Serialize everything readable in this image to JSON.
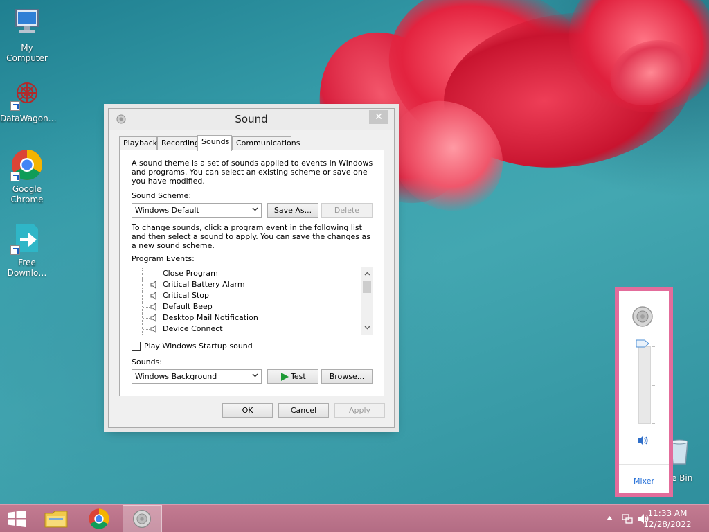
{
  "desktop": {
    "icons": [
      {
        "label": "My Computer",
        "icon": "computer-icon"
      },
      {
        "label": "DataWagon…",
        "icon": "datawagon-icon"
      },
      {
        "label": "Google Chrome",
        "icon": "chrome-icon"
      },
      {
        "label": "Free Downlo…",
        "icon": "download-manager-icon"
      }
    ],
    "recycle_bin_label": "cle Bin"
  },
  "dialog": {
    "title": "Sound",
    "tabs": [
      {
        "label": "Playback",
        "active": false
      },
      {
        "label": "Recording",
        "active": false
      },
      {
        "label": "Sounds",
        "active": true
      },
      {
        "label": "Communications",
        "active": false
      }
    ],
    "intro_text": "A sound theme is a set of sounds applied to events in Windows and programs.  You can select an existing scheme or save one you have modified.",
    "scheme_label": "Sound Scheme:",
    "scheme_value": "Windows Default",
    "save_as_label": "Save As...",
    "delete_label": "Delete",
    "change_text": "To change sounds, click a program event in the following list and then select a sound to apply.  You can save the changes as a new sound scheme.",
    "events_label": "Program Events:",
    "events": [
      {
        "label": "Close Program",
        "has_sound": false
      },
      {
        "label": "Critical Battery Alarm",
        "has_sound": true
      },
      {
        "label": "Critical Stop",
        "has_sound": true
      },
      {
        "label": "Default Beep",
        "has_sound": true
      },
      {
        "label": "Desktop Mail Notification",
        "has_sound": true
      },
      {
        "label": "Device Connect",
        "has_sound": true
      }
    ],
    "startup_label": "Play Windows Startup sound",
    "startup_checked": false,
    "sounds_label": "Sounds:",
    "sound_value": "Windows Background",
    "test_label": "Test",
    "browse_label": "Browse...",
    "ok_label": "OK",
    "cancel_label": "Cancel",
    "apply_label": "Apply"
  },
  "volume": {
    "level": 1.0,
    "mixer_label": "Mixer"
  },
  "taskbar": {
    "pinned": [
      "file-explorer-icon",
      "chrome-icon"
    ],
    "active_item": "sound-icon",
    "time": "11:33 AM",
    "date": "12/28/2022"
  },
  "colors": {
    "taskbar": "#b36c84",
    "flyout_border": "#e36c9b",
    "link": "#1e6bd6"
  }
}
